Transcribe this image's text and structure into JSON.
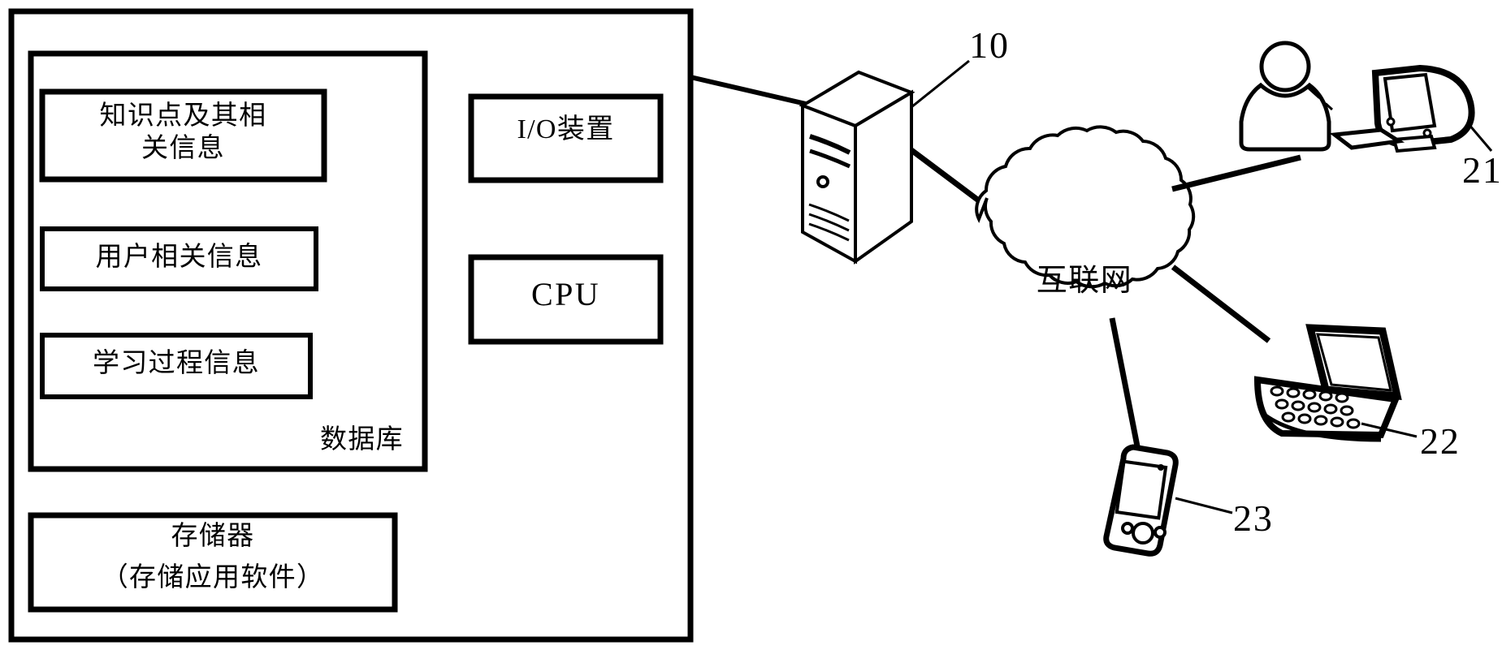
{
  "figure": {
    "type": "system-architecture-block-diagram",
    "language": "zh-CN",
    "description": "Patent figure: a server system block (10) connected through the Internet to three client terminals (21 desktop computer with user, 22 laptop, 23 mobile phone)."
  },
  "server_block": {
    "name": "server-system-block",
    "database": {
      "label": "数据库",
      "items": [
        {
          "id": "knowledge-points",
          "label": "知识点及其相\n关信息"
        },
        {
          "id": "user-info",
          "label": "用户相关信息"
        },
        {
          "id": "learning-process",
          "label": "学习过程信息"
        }
      ]
    },
    "storage": {
      "id": "storage-memory",
      "line1": "存储器",
      "line2": "（存储应用软件）"
    },
    "io_device": {
      "id": "io-device",
      "label": "I/O装置"
    },
    "cpu": {
      "id": "cpu",
      "label": "CPU"
    }
  },
  "network": {
    "cloud_label": "互联网",
    "server_ref": "10",
    "nodes": [
      {
        "id": "desktop-terminal",
        "ref": "21"
      },
      {
        "id": "laptop-terminal",
        "ref": "22"
      },
      {
        "id": "mobile-terminal",
        "ref": "23"
      }
    ]
  },
  "colors": {
    "ink": "#000000",
    "paper": "#ffffff"
  }
}
